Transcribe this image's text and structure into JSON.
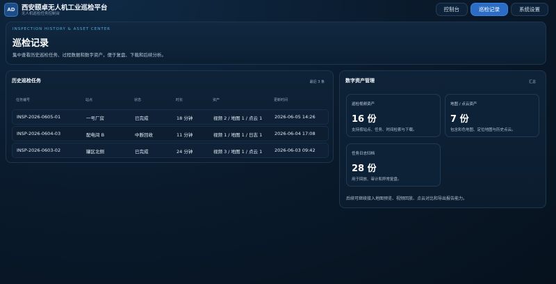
{
  "header": {
    "logo_text": "AD",
    "title": "西安颐卓无人机工业巡检平台",
    "subtitle": "无人机巡检任务控制台",
    "nav": [
      {
        "label": "控制台",
        "active": false
      },
      {
        "label": "巡检记录",
        "active": true
      },
      {
        "label": "系统设置",
        "active": false
      }
    ]
  },
  "hero": {
    "eyebrow": "INSPECTION HISTORY & ASSET CENTER",
    "title": "巡检记录",
    "description": "集中查看历史巡检任务、过程数据和数字资产，便于复盘、下载和后续分析。"
  },
  "history": {
    "title": "历史巡检任务",
    "tag": "最近 3 条",
    "columns": [
      "任务编号",
      "站点",
      "状态",
      "时长",
      "资产",
      "更新时间"
    ],
    "rows": [
      [
        "INSP-2026-0605-01",
        "一号厂房",
        "已完成",
        "18 分钟",
        "视频 2 / 地图 1 / 点云 1",
        "2026-06-05 14:26"
      ],
      [
        "INSP-2026-0604-03",
        "配电间 B",
        "中断回收",
        "11 分钟",
        "视频 1 / 地图 1 / 日志 1",
        "2026-06-04 17:08"
      ],
      [
        "INSP-2026-0603-02",
        "罐区北侧",
        "已完成",
        "24 分钟",
        "视频 3 / 地图 1 / 点云 1",
        "2026-06-03 09:42"
      ]
    ]
  },
  "assets": {
    "title": "数字资产管理",
    "tag": "汇总",
    "cards": [
      {
        "label": "巡检视频资产",
        "value": "16 份",
        "desc": "支持按站点、任务、时间检索与下载。"
      },
      {
        "label": "地图 / 点云资产",
        "value": "7 份",
        "desc": "包含彩色地图、定位地图与历史点云。"
      },
      {
        "label": "任务日志归档",
        "value": "28 份",
        "desc": "用于回放、审计和异常复盘。"
      }
    ],
    "footnote": "后续可继续接入地图预览、视频回放、点云对比和导出报告能力。"
  }
}
